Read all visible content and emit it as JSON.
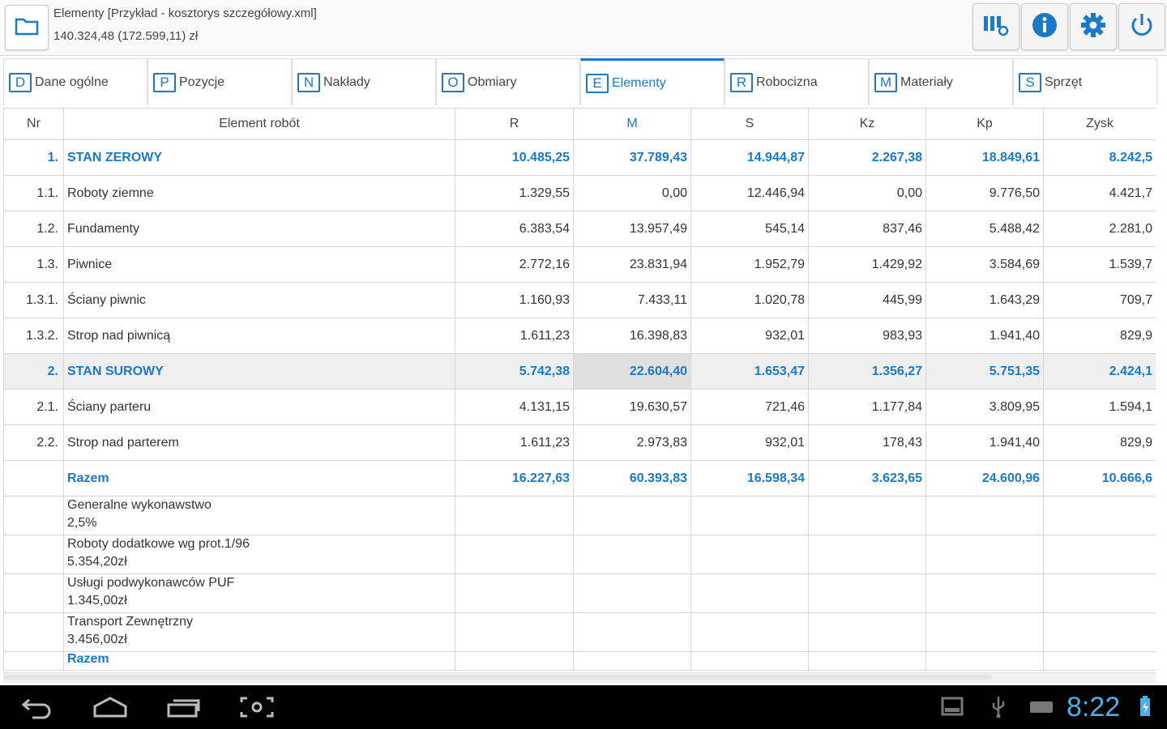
{
  "header": {
    "title": "Elementy [Przykład - kosztorys szczegółowy.xml]",
    "amount": "140.324,48 (172.599,11) zł",
    "icons": [
      "folder-icon",
      "columns-settings-icon",
      "info-icon",
      "gear-icon",
      "power-icon"
    ]
  },
  "tabs": [
    {
      "key": "D",
      "label": "Dane ogólne"
    },
    {
      "key": "P",
      "label": "Pozycje"
    },
    {
      "key": "N",
      "label": "Nakłady"
    },
    {
      "key": "O",
      "label": "Obmiary"
    },
    {
      "key": "E",
      "label": "Elementy",
      "active": true
    },
    {
      "key": "R",
      "label": "Robocizna"
    },
    {
      "key": "M",
      "label": "Materiały"
    },
    {
      "key": "S",
      "label": "Sprzęt"
    }
  ],
  "table": {
    "columns": [
      "Nr",
      "Element robót",
      "R",
      "M",
      "S",
      "Kz",
      "Kp",
      "Zysk"
    ],
    "rows": [
      {
        "nr": "1.",
        "name": "STAN ZEROWY",
        "R": "10.485,25",
        "M": "37.789,43",
        "S": "14.944,87",
        "Kz": "2.267,38",
        "Kp": "18.849,61",
        "Zysk": "8.242,5",
        "type": "head"
      },
      {
        "nr": "1.1.",
        "name": "Roboty ziemne",
        "R": "1.329,55",
        "M": "0,00",
        "S": "12.446,94",
        "Kz": "0,00",
        "Kp": "9.776,50",
        "Zysk": "4.421,7"
      },
      {
        "nr": "1.2.",
        "name": "Fundamenty",
        "R": "6.383,54",
        "M": "13.957,49",
        "S": "545,14",
        "Kz": "837,46",
        "Kp": "5.488,42",
        "Zysk": "2.281,0"
      },
      {
        "nr": "1.3.",
        "name": "Piwnice",
        "R": "2.772,16",
        "M": "23.831,94",
        "S": "1.952,79",
        "Kz": "1.429,92",
        "Kp": "3.584,69",
        "Zysk": "1.539,7"
      },
      {
        "nr": "1.3.1.",
        "name": "Ściany piwnic",
        "R": "1.160,93",
        "M": "7.433,11",
        "S": "1.020,78",
        "Kz": "445,99",
        "Kp": "1.643,29",
        "Zysk": "709,7"
      },
      {
        "nr": "1.3.2.",
        "name": "Strop nad piwnicą",
        "R": "1.611,23",
        "M": "16.398,83",
        "S": "932,01",
        "Kz": "983,93",
        "Kp": "1.941,40",
        "Zysk": "829,9"
      },
      {
        "nr": "2.",
        "name": "STAN SUROWY",
        "R": "5.742,38",
        "M": "22.604,40",
        "S": "1.653,47",
        "Kz": "1.356,27",
        "Kp": "5.751,35",
        "Zysk": "2.424,1",
        "type": "head",
        "selected": true
      },
      {
        "nr": "2.1.",
        "name": "Ściany parteru",
        "R": "4.131,15",
        "M": "19.630,57",
        "S": "721,46",
        "Kz": "1.177,84",
        "Kp": "3.809,95",
        "Zysk": "1.594,1"
      },
      {
        "nr": "2.2.",
        "name": "Strop nad parterem",
        "R": "1.611,23",
        "M": "2.973,83",
        "S": "932,01",
        "Kz": "178,43",
        "Kp": "1.941,40",
        "Zysk": "829,9"
      }
    ],
    "total": {
      "name": "Razem",
      "R": "16.227,63",
      "M": "60.393,83",
      "S": "16.598,34",
      "Kz": "3.623,65",
      "Kp": "24.600,96",
      "Zysk": "10.666,6"
    },
    "extras": [
      {
        "line1": "Generalne wykonawstwo",
        "line2": "2,5%"
      },
      {
        "line1": "Roboty dodatkowe wg prot.1/96",
        "line2": "5.354,20zł"
      },
      {
        "line1": "Usługi podwykonawców PUF",
        "line2": "1.345,00zł"
      },
      {
        "line1": "Transport Zewnętrzny",
        "line2": "3.456,00zł"
      }
    ],
    "razem2": "Razem"
  },
  "statusbar": {
    "time": "8:22",
    "icons": [
      "back-icon",
      "home-icon",
      "recent-apps-icon",
      "screenshot-icon",
      "gallery-icon",
      "usb-icon",
      "keyboard-icon",
      "battery-icon"
    ]
  },
  "colors": {
    "accent": "#1a79c9",
    "clock": "#4ab0e8"
  }
}
